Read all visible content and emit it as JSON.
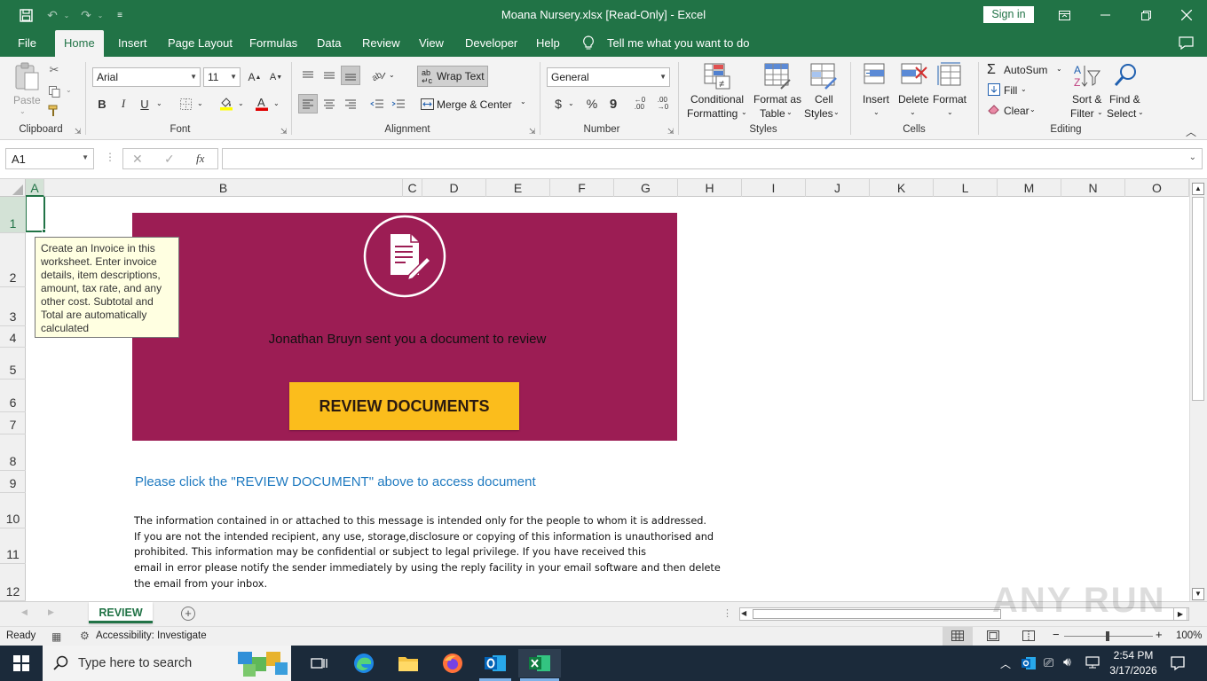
{
  "window": {
    "title": "Moana Nursery.xlsx  [Read-Only]  -  Excel",
    "sign_in": "Sign in"
  },
  "tabs": [
    "File",
    "Home",
    "Insert",
    "Page Layout",
    "Formulas",
    "Data",
    "Review",
    "View",
    "Developer",
    "Help"
  ],
  "active_tab": "Home",
  "tell_me": "Tell me what you want to do",
  "ribbon": {
    "clipboard": {
      "paste": "Paste",
      "label": "Clipboard"
    },
    "font": {
      "name": "Arial",
      "size": "11",
      "bold": "B",
      "italic": "I",
      "underline": "U",
      "label": "Font"
    },
    "alignment": {
      "wrap_text": "Wrap Text",
      "merge_center": "Merge & Center",
      "label": "Alignment"
    },
    "number": {
      "format": "General",
      "currency": "$",
      "percent": "%",
      "comma": "9",
      "label": "Number"
    },
    "styles": {
      "conditional_1": "Conditional",
      "conditional_2": "Formatting",
      "format_table_1": "Format as",
      "format_table_2": "Table",
      "cell_styles_1": "Cell",
      "cell_styles_2": "Styles",
      "label": "Styles"
    },
    "cells": {
      "insert": "Insert",
      "delete": "Delete",
      "format": "Format",
      "label": "Cells"
    },
    "editing": {
      "autosum": "AutoSum",
      "fill": "Fill",
      "clear": "Clear",
      "sort_1": "Sort &",
      "sort_2": "Filter",
      "find_1": "Find &",
      "find_2": "Select",
      "label": "Editing"
    }
  },
  "formula_bar": {
    "name_box": "A1",
    "fx": "fx",
    "cancel": "✕",
    "enter": "✓",
    "value": ""
  },
  "columns": [
    "A",
    "B",
    "C",
    "D",
    "E",
    "F",
    "G",
    "H",
    "I",
    "J",
    "K",
    "L",
    "M",
    "N",
    "O"
  ],
  "rows": [
    "1",
    "2",
    "3",
    "4",
    "5",
    "6",
    "7",
    "8",
    "9",
    "10",
    "11",
    "12"
  ],
  "comment": "Create an Invoice in this worksheet. Enter invoice details, item descriptions, amount, tax rate, and any other cost. Subtotal and Total are automatically calculated",
  "banner": {
    "sender_text": "Jonathan Bruyn sent you a document to review",
    "button_label": "REVIEW DOCUMENTS",
    "bg_color": "#9c1d54",
    "button_color": "#fbbd1c"
  },
  "instruction": "Please click the \"REVIEW DOCUMENT\" above to access document",
  "disclaimer_lines": [
    "The information contained in or attached to this message is intended only for the people to whom it is addressed.",
    "If you are not the intended recipient, any use, storage,disclosure or copying of this information is unauthorised and",
    "prohibited. This information may be confidential or subject to legal privilege. If you have received this",
    "email in error please notify the sender immediately by using the reply facility in your email software and then delete",
    "the email from your inbox."
  ],
  "sheet_tab": "REVIEW",
  "status": {
    "ready": "Ready",
    "accessibility": "Accessibility: Investigate",
    "zoom": "100%"
  },
  "taskbar": {
    "search_placeholder": "Type here to search",
    "time": "2:54 PM",
    "date": "3/17/2026"
  },
  "watermark": "ANY RUN",
  "colors": {
    "excel_green": "#217346",
    "link_blue": "#1f7ac0"
  }
}
